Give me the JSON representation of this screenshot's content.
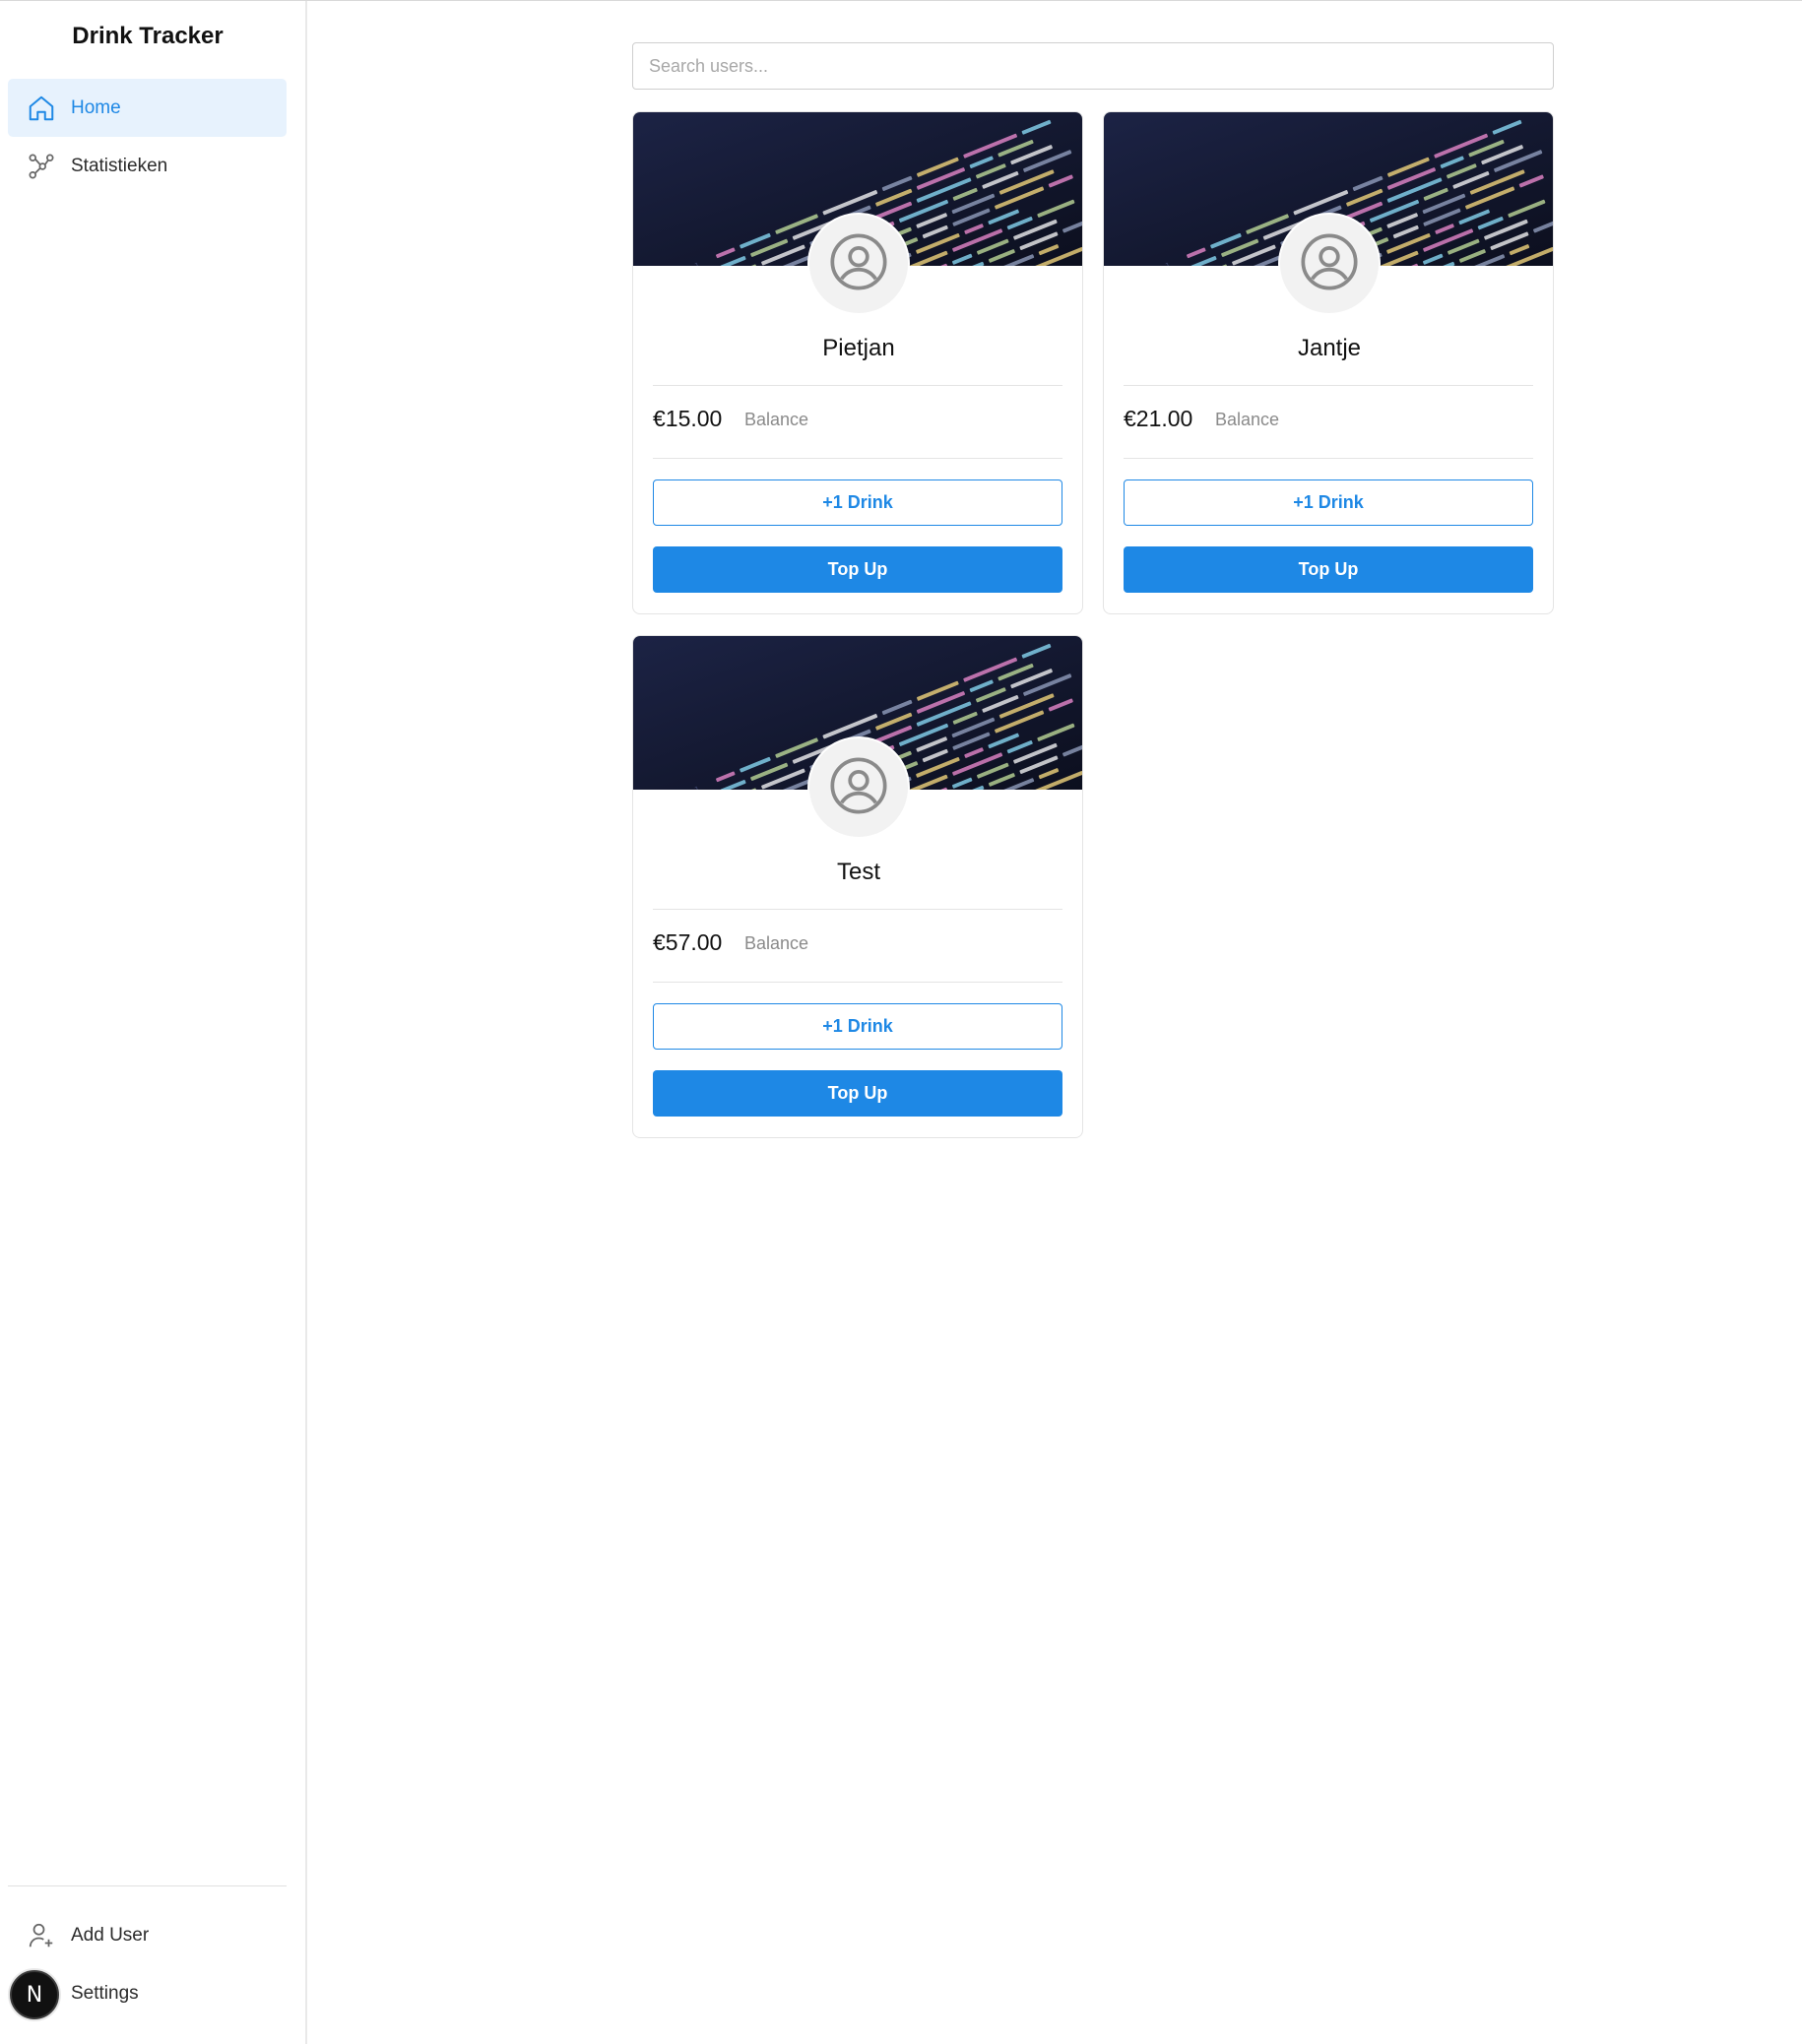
{
  "app": {
    "title": "Drink Tracker"
  },
  "sidebar": {
    "items": [
      {
        "label": "Home",
        "icon": "home-icon",
        "active": true
      },
      {
        "label": "Statistieken",
        "icon": "chart-nodes-icon",
        "active": false
      }
    ],
    "bottom_items": [
      {
        "label": "Add User",
        "icon": "add-user-icon"
      },
      {
        "label": "Settings",
        "icon": "settings-icon"
      }
    ],
    "avatar_letter": "N"
  },
  "search": {
    "placeholder": "Search users...",
    "value": ""
  },
  "users": [
    {
      "name": "Pietjan",
      "balance": "€15.00",
      "balance_label": "Balance",
      "drink_label": "+1 Drink",
      "topup_label": "Top Up"
    },
    {
      "name": "Jantje",
      "balance": "€21.00",
      "balance_label": "Balance",
      "drink_label": "+1 Drink",
      "topup_label": "Top Up"
    },
    {
      "name": "Test",
      "balance": "€57.00",
      "balance_label": "Balance",
      "drink_label": "+1 Drink",
      "topup_label": "Top Up"
    }
  ],
  "colors": {
    "accent": "#1e88e5",
    "active_bg": "#e7f2fd",
    "banner_bg": "#141a33"
  }
}
